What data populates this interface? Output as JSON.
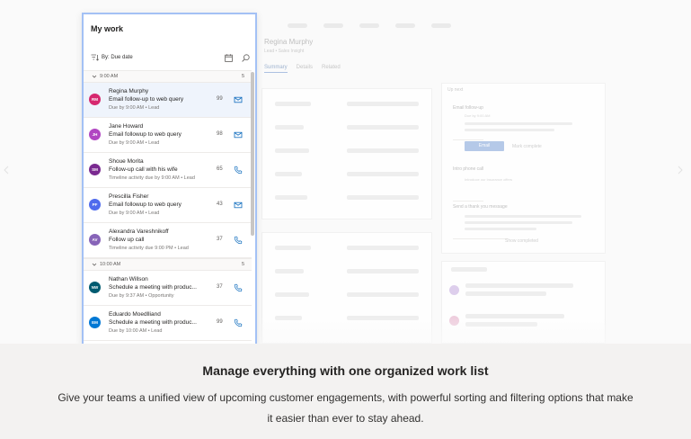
{
  "background_app": {
    "contact_name": "Regina Murphy",
    "contact_subtitle": "Lead • Sales Insight",
    "tabs": [
      "Summary",
      "Details",
      "Related"
    ],
    "up_next": {
      "header": "Up next",
      "steps": [
        {
          "title": "Email follow-up",
          "due": "Due by 9:00 AM"
        },
        {
          "title": "Intro phone call",
          "note": "Introduce our insurance offers"
        },
        {
          "title": "Send a thank you message"
        }
      ],
      "email_button": "Email",
      "mark_complete": "Mark complete",
      "show_completed": "Show completed"
    }
  },
  "panel": {
    "title": "My work",
    "sort_label": "By: Due date",
    "groups": [
      {
        "label": "9:00 AM",
        "count": "5",
        "items": [
          {
            "initials": "RM",
            "color": "#d6286f",
            "name": "Regina Murphy",
            "activity": "Email follow-up to web query",
            "due": "Due by 9:00 AM • Lead",
            "score": "99",
            "icon": "mail-icon",
            "selected": true
          },
          {
            "initials": "JH",
            "color": "#b146c2",
            "name": "Jane Howard",
            "activity": "Email followup to web query",
            "due": "Due by 9:00 AM • Lead",
            "score": "98",
            "icon": "mail-icon"
          },
          {
            "initials": "SM",
            "color": "#7a2a90",
            "name": "Shoue Morita",
            "activity": "Follow-up call with his wife",
            "due": "Timeline activity due by 9:00 AM • Lead",
            "score": "65",
            "icon": "phone-icon"
          },
          {
            "initials": "PF",
            "color": "#4f6bed",
            "name": "Prescilla Fisher",
            "activity": "Email followup to web query",
            "due": "Due by 9:00 AM • Lead",
            "score": "43",
            "icon": "mail-icon"
          },
          {
            "initials": "AV",
            "color": "#8764b8",
            "name": "Alexandra Vareshnikoff",
            "activity": "Follow up call",
            "due": "Timeline activity due 9:00 PM • Lead",
            "score": "37",
            "icon": "phone-icon"
          }
        ]
      },
      {
        "label": "10:00 AM",
        "count": "5",
        "items": [
          {
            "initials": "NW",
            "color": "#005b70",
            "name": "Nathan Willson",
            "activity": "Schedule a meeting with produc...",
            "due": "Due by 9:37 AM • Opportunity",
            "score": "37",
            "icon": "phone-icon"
          },
          {
            "initials": "EM",
            "color": "#0078d4",
            "name": "Eduardo Moedlliand",
            "activity": "Schedule a meeting with produc...",
            "due": "Due by 10:00 AM • Lead",
            "score": "99",
            "icon": "phone-icon"
          }
        ]
      }
    ]
  },
  "caption": {
    "title": "Manage everything with one organized work list",
    "body": "Give your teams a unified view of upcoming customer engagements, with powerful sorting and filtering options that make it easier than ever to stay ahead."
  },
  "colors": {
    "accent": "#0f6cbd",
    "panel_border": "#a3c1f5",
    "selected_row": "#eff4fc"
  }
}
